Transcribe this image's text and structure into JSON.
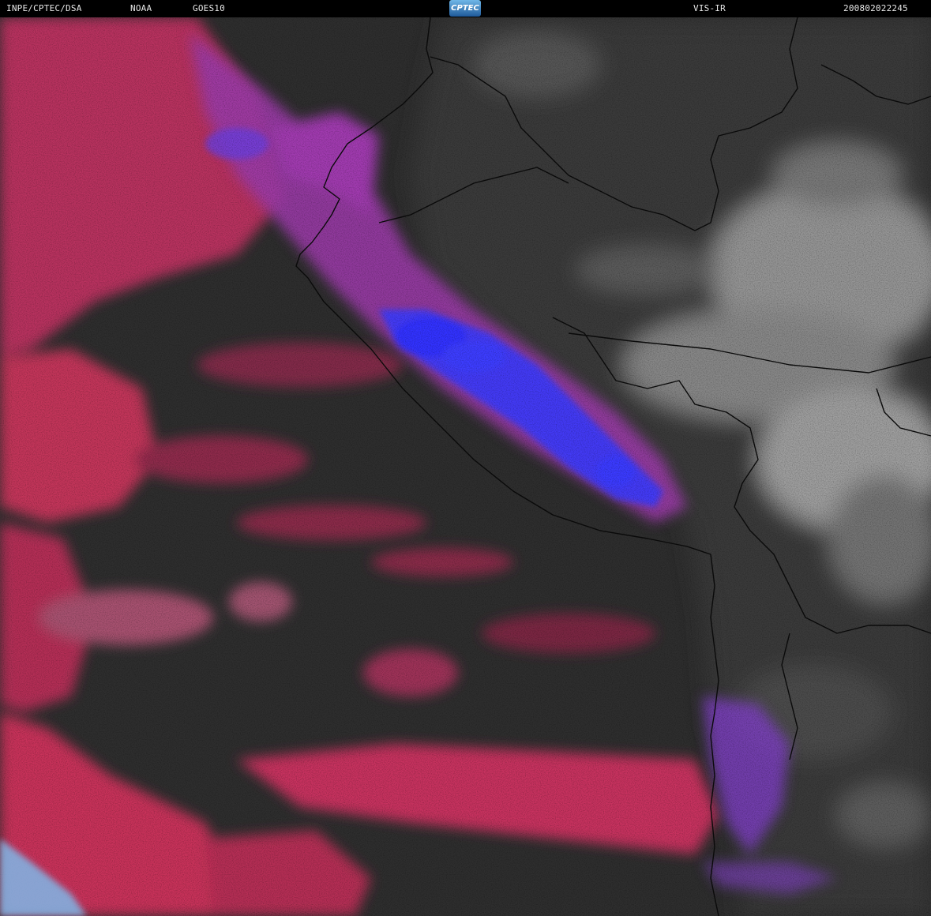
{
  "header": {
    "institution": "INPE/CPTEC/DSA",
    "agency": "NOAA",
    "satellite": "GOES10",
    "logo_text": "CPTEC",
    "channel": "VIS-IR",
    "timestamp": "200802022245"
  },
  "colors": {
    "header_bg": "#000000",
    "ocean_dark": "#2e2e2e",
    "low_cloud_red": "#c8305a",
    "mid_cloud_magenta": "#9a38a8",
    "high_cloud_blue": "#3a3aff",
    "land_cloud_gray": "#bdbdbd"
  }
}
